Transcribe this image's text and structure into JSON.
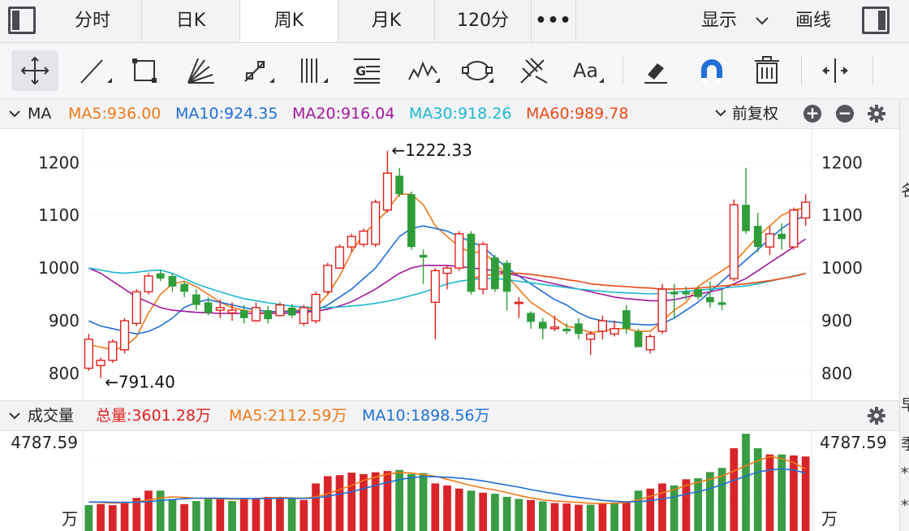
{
  "tabs": [
    "分时",
    "日K",
    "周K",
    "月K",
    "120分",
    "•••"
  ],
  "active_tab": "周K",
  "display_menu": "显示",
  "draw_label": "画线",
  "ma_bar": {
    "label": "MA",
    "items": [
      {
        "text": "MA5:936.00",
        "color": "#f07a17"
      },
      {
        "text": "MA10:924.35",
        "color": "#1f6fd6"
      },
      {
        "text": "MA20:916.04",
        "color": "#a3179e"
      },
      {
        "text": "MA30:918.26",
        "color": "#1bb7d1"
      },
      {
        "text": "MA60:989.78",
        "color": "#ea4a16"
      }
    ],
    "adjust": "前复权"
  },
  "vol_bar": {
    "label": "成交量",
    "items": [
      {
        "text": "总量:3601.28万",
        "color": "#e0201b"
      },
      {
        "text": "MA5:2112.59万",
        "color": "#f07a17"
      },
      {
        "text": "MA10:1898.56万",
        "color": "#1f6fd6"
      }
    ]
  },
  "right_strip_text": [
    "名",
    "早",
    "季",
    "*",
    "*"
  ],
  "chart_data": [
    {
      "type": "candlestick",
      "x_count": 61,
      "y_axis_ticks": [
        "1200",
        "1100",
        "1000",
        "900",
        "800"
      ],
      "ylim": [
        780,
        1230
      ],
      "annotations": [
        {
          "text": "←1222.33",
          "value": 1222.33
        },
        {
          "text": "←791.40",
          "value": 791.4
        }
      ],
      "candles": [
        {
          "o": 810,
          "h": 875,
          "l": 805,
          "c": 865
        },
        {
          "o": 815,
          "h": 830,
          "l": 791.4,
          "c": 825
        },
        {
          "o": 825,
          "h": 865,
          "l": 820,
          "c": 860
        },
        {
          "o": 845,
          "h": 905,
          "l": 838,
          "c": 900
        },
        {
          "o": 895,
          "h": 960,
          "l": 890,
          "c": 955
        },
        {
          "o": 955,
          "h": 990,
          "l": 950,
          "c": 985
        },
        {
          "o": 990,
          "h": 995,
          "l": 975,
          "c": 980
        },
        {
          "o": 985,
          "h": 990,
          "l": 955,
          "c": 965
        },
        {
          "o": 970,
          "h": 975,
          "l": 945,
          "c": 955
        },
        {
          "o": 950,
          "h": 960,
          "l": 920,
          "c": 930
        },
        {
          "o": 935,
          "h": 945,
          "l": 910,
          "c": 915
        },
        {
          "o": 920,
          "h": 940,
          "l": 905,
          "c": 925
        },
        {
          "o": 915,
          "h": 935,
          "l": 900,
          "c": 920
        },
        {
          "o": 920,
          "h": 930,
          "l": 895,
          "c": 905
        },
        {
          "o": 900,
          "h": 935,
          "l": 898,
          "c": 925
        },
        {
          "o": 920,
          "h": 928,
          "l": 895,
          "c": 903
        },
        {
          "o": 910,
          "h": 935,
          "l": 908,
          "c": 930
        },
        {
          "o": 925,
          "h": 932,
          "l": 905,
          "c": 910
        },
        {
          "o": 895,
          "h": 930,
          "l": 890,
          "c": 925
        },
        {
          "o": 900,
          "h": 955,
          "l": 895,
          "c": 950
        },
        {
          "o": 955,
          "h": 1010,
          "l": 950,
          "c": 1005
        },
        {
          "o": 1000,
          "h": 1045,
          "l": 998,
          "c": 1040
        },
        {
          "o": 1040,
          "h": 1065,
          "l": 1030,
          "c": 1060
        },
        {
          "o": 1045,
          "h": 1075,
          "l": 1040,
          "c": 1070
        },
        {
          "o": 1045,
          "h": 1130,
          "l": 1040,
          "c": 1125
        },
        {
          "o": 1110,
          "h": 1222.33,
          "l": 1105,
          "c": 1180
        },
        {
          "o": 1175,
          "h": 1190,
          "l": 1135,
          "c": 1140
        },
        {
          "o": 1140,
          "h": 1145,
          "l": 1035,
          "c": 1040
        },
        {
          "o": 1025,
          "h": 1035,
          "l": 970,
          "c": 1020
        },
        {
          "o": 935,
          "h": 1000,
          "l": 865,
          "c": 995
        },
        {
          "o": 990,
          "h": 1005,
          "l": 960,
          "c": 1000
        },
        {
          "o": 1000,
          "h": 1070,
          "l": 995,
          "c": 1065
        },
        {
          "o": 1065,
          "h": 1070,
          "l": 950,
          "c": 955
        },
        {
          "o": 960,
          "h": 1050,
          "l": 950,
          "c": 1045
        },
        {
          "o": 1020,
          "h": 1025,
          "l": 955,
          "c": 960
        },
        {
          "o": 1010,
          "h": 1015,
          "l": 920,
          "c": 955
        },
        {
          "o": 935,
          "h": 945,
          "l": 905,
          "c": 935
        },
        {
          "o": 915,
          "h": 918,
          "l": 885,
          "c": 898
        },
        {
          "o": 898,
          "h": 905,
          "l": 865,
          "c": 885
        },
        {
          "o": 885,
          "h": 910,
          "l": 880,
          "c": 888
        },
        {
          "o": 885,
          "h": 895,
          "l": 875,
          "c": 880
        },
        {
          "o": 895,
          "h": 905,
          "l": 865,
          "c": 875
        },
        {
          "o": 865,
          "h": 880,
          "l": 835,
          "c": 875
        },
        {
          "o": 880,
          "h": 910,
          "l": 865,
          "c": 900
        },
        {
          "o": 875,
          "h": 900,
          "l": 870,
          "c": 885
        },
        {
          "o": 920,
          "h": 930,
          "l": 875,
          "c": 885
        },
        {
          "o": 880,
          "h": 885,
          "l": 850,
          "c": 850
        },
        {
          "o": 845,
          "h": 875,
          "l": 838,
          "c": 870
        },
        {
          "o": 880,
          "h": 970,
          "l": 875,
          "c": 960
        },
        {
          "o": 955,
          "h": 970,
          "l": 905,
          "c": 950
        },
        {
          "o": 955,
          "h": 965,
          "l": 940,
          "c": 950
        },
        {
          "o": 960,
          "h": 965,
          "l": 940,
          "c": 945
        },
        {
          "o": 945,
          "h": 975,
          "l": 925,
          "c": 935
        },
        {
          "o": 935,
          "h": 960,
          "l": 920,
          "c": 930
        },
        {
          "o": 980,
          "h": 1130,
          "l": 975,
          "c": 1120
        },
        {
          "o": 1120,
          "h": 1190,
          "l": 1065,
          "c": 1070
        },
        {
          "o": 1080,
          "h": 1105,
          "l": 1030,
          "c": 1040
        },
        {
          "o": 1040,
          "h": 1080,
          "l": 1025,
          "c": 1065
        },
        {
          "o": 1065,
          "h": 1085,
          "l": 1035,
          "c": 1055
        },
        {
          "o": 1040,
          "h": 1115,
          "l": 1035,
          "c": 1110
        },
        {
          "o": 1095,
          "h": 1140,
          "l": 1080,
          "c": 1125
        }
      ],
      "ma_lines": [
        {
          "name": "MA5",
          "color": "#f07a17",
          "values": [
            855,
            850,
            845,
            850,
            870,
            915,
            950,
            970,
            975,
            965,
            950,
            935,
            925,
            920,
            915,
            915,
            918,
            920,
            920,
            925,
            950,
            985,
            1030,
            1065,
            1085,
            1110,
            1140,
            1140,
            1120,
            1080,
            1060,
            1040,
            1030,
            1030,
            1010,
            985,
            960,
            935,
            920,
            905,
            890,
            885,
            878,
            880,
            885,
            885,
            880,
            880,
            900,
            920,
            935,
            965,
            980,
            995,
            1010,
            1035,
            1060,
            1080,
            1100,
            1110,
            1115
          ]
        },
        {
          "name": "MA10",
          "color": "#1f6fd6",
          "values": [
            900,
            890,
            885,
            880,
            875,
            880,
            890,
            905,
            925,
            935,
            940,
            935,
            930,
            925,
            920,
            918,
            917,
            918,
            918,
            920,
            930,
            945,
            960,
            980,
            1000,
            1030,
            1060,
            1075,
            1080,
            1075,
            1070,
            1060,
            1050,
            1040,
            1020,
            1000,
            985,
            970,
            955,
            940,
            930,
            915,
            905,
            900,
            898,
            895,
            893,
            892,
            895,
            905,
            920,
            935,
            955,
            975,
            995,
            1015,
            1035,
            1055,
            1075,
            1090,
            1100
          ]
        },
        {
          "name": "MA20",
          "color": "#a3179e",
          "values": [
            1000,
            990,
            975,
            960,
            945,
            935,
            925,
            920,
            918,
            916,
            915,
            914,
            914,
            914,
            914,
            914,
            914,
            915,
            916,
            918,
            922,
            928,
            936,
            948,
            960,
            975,
            990,
            1000,
            1005,
            1005,
            1005,
            1003,
            1000,
            998,
            995,
            990,
            985,
            980,
            975,
            970,
            965,
            960,
            955,
            950,
            945,
            942,
            940,
            938,
            938,
            940,
            945,
            950,
            955,
            960,
            970,
            980,
            995,
            1010,
            1025,
            1040,
            1055
          ]
        },
        {
          "name": "MA30",
          "color": "#1bb7d1",
          "values": [
            1000,
            996,
            992,
            990,
            992,
            995,
            996,
            990,
            980,
            970,
            962,
            955,
            948,
            942,
            938,
            934,
            931,
            928,
            926,
            925,
            925,
            926,
            928,
            930,
            933,
            937,
            942,
            948,
            954,
            962,
            970,
            975,
            978,
            980,
            980,
            978,
            975,
            972,
            969,
            966,
            963,
            960,
            958,
            956,
            954,
            953,
            952,
            951,
            952,
            954,
            956,
            958,
            960,
            962,
            964,
            966,
            970,
            975,
            980,
            985,
            990
          ]
        },
        {
          "name": "MA60",
          "color": "#ea4a16",
          "values": [
            null,
            null,
            null,
            null,
            null,
            null,
            null,
            null,
            null,
            null,
            null,
            null,
            null,
            null,
            null,
            null,
            null,
            null,
            null,
            null,
            null,
            null,
            null,
            null,
            null,
            null,
            null,
            null,
            null,
            null,
            null,
            null,
            980,
            985,
            988,
            990,
            990,
            988,
            985,
            982,
            978,
            975,
            970,
            968,
            966,
            965,
            963,
            962,
            960,
            960,
            961,
            962,
            964,
            966,
            968,
            970,
            973,
            976,
            980,
            984,
            989.78
          ]
        }
      ]
    },
    {
      "type": "bar",
      "title": "成交量",
      "y_axis_labels": [
        "4787.59",
        "万"
      ],
      "ymax": 4787.59,
      "unit": "万",
      "values": [
        1250,
        1300,
        1250,
        1420,
        1600,
        1950,
        1950,
        1550,
        1300,
        1450,
        1600,
        1550,
        1450,
        1600,
        1600,
        1650,
        1620,
        1580,
        1500,
        2300,
        2650,
        2700,
        2820,
        2750,
        2840,
        2900,
        2950,
        2750,
        2800,
        2300,
        2200,
        2050,
        1950,
        1850,
        1800,
        1650,
        1550,
        1500,
        1430,
        1350,
        1330,
        1270,
        1270,
        1330,
        1380,
        1400,
        1950,
        2050,
        2300,
        2200,
        2500,
        2550,
        2850,
        3050,
        4000,
        4700,
        4000,
        3700,
        3700,
        3650,
        3601.28
      ],
      "up": [
        false,
        true,
        true,
        true,
        true,
        true,
        false,
        false,
        true,
        false,
        false,
        true,
        false,
        true,
        true,
        true,
        true,
        false,
        true,
        true,
        true,
        true,
        true,
        true,
        true,
        true,
        false,
        false,
        false,
        true,
        true,
        true,
        false,
        true,
        false,
        false,
        false,
        true,
        false,
        true,
        true,
        true,
        false,
        true,
        false,
        true,
        false,
        true,
        true,
        false,
        true,
        false,
        false,
        false,
        true,
        false,
        false,
        true,
        false,
        true,
        true
      ],
      "ma_lines": [
        {
          "name": "MA5",
          "color": "#f07a17",
          "values": [
            1400,
            1380,
            1350,
            1360,
            1400,
            1500,
            1600,
            1650,
            1620,
            1580,
            1570,
            1560,
            1540,
            1550,
            1560,
            1600,
            1620,
            1600,
            1580,
            1650,
            1800,
            2000,
            2200,
            2450,
            2600,
            2750,
            2830,
            2800,
            2720,
            2650,
            2500,
            2350,
            2200,
            2080,
            1980,
            1860,
            1720,
            1600,
            1500,
            1450,
            1420,
            1380,
            1340,
            1330,
            1340,
            1380,
            1500,
            1680,
            1850,
            2000,
            2200,
            2350,
            2500,
            2650,
            2900,
            3150,
            3400,
            3600,
            3500,
            3300,
            3000
          ]
        },
        {
          "name": "MA10",
          "color": "#1f6fd6",
          "values": [
            1400,
            1400,
            1390,
            1380,
            1390,
            1420,
            1470,
            1520,
            1560,
            1590,
            1590,
            1580,
            1570,
            1560,
            1560,
            1570,
            1580,
            1580,
            1570,
            1600,
            1680,
            1780,
            1900,
            2050,
            2200,
            2350,
            2480,
            2580,
            2620,
            2620,
            2600,
            2560,
            2500,
            2420,
            2320,
            2220,
            2120,
            2000,
            1900,
            1800,
            1700,
            1620,
            1550,
            1480,
            1440,
            1410,
            1420,
            1470,
            1550,
            1650,
            1780,
            1900,
            2050,
            2250,
            2450,
            2650,
            2850,
            2950,
            3000,
            2950,
            2800
          ]
        }
      ]
    }
  ]
}
